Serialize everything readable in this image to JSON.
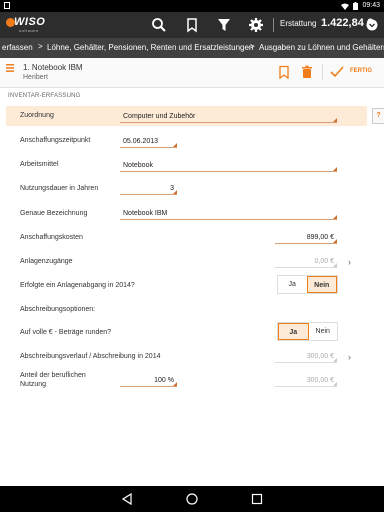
{
  "statusbar": {
    "time": "09:43"
  },
  "appbar": {
    "brand": "WISO",
    "brand_sub": "software",
    "erstattung_label": "Erstattung",
    "erstattung_value": "1.422,84 €"
  },
  "breadcrumb": {
    "items": [
      "erfassen",
      "Löhne, Gehälter, Pensionen, Renten und Ersatzleistungen",
      "Ausgaben zu Löhnen und Gehältern"
    ]
  },
  "header": {
    "title": "1. Notebook IBM",
    "subtitle": "Heribert",
    "done_label": "FERTIG"
  },
  "section_title": "INVENTAR-ERFASSUNG",
  "side_tab": "?",
  "form": {
    "zuordnung": {
      "label": "Zuordnung",
      "value": "Computer und Zubehör"
    },
    "anschaffungszeitpunkt": {
      "label": "Anschaffungszeitpunkt",
      "value": "05.06.2013"
    },
    "arbeitsmittel": {
      "label": "Arbeitsmittel",
      "value": "Notebook"
    },
    "nutzungsdauer": {
      "label": "Nutzungsdauer in Jahren",
      "value": "3"
    },
    "genaue_bezeichnung": {
      "label": "Genaue Bezeichnung",
      "value": "Notebook IBM"
    },
    "anschaffungskosten": {
      "label": "Anschaffungskosten",
      "value": "899,00 €"
    },
    "anlagenzugaenge": {
      "label": "Anlagenzugänge",
      "value": "0,00 €"
    },
    "anlagenabgang": {
      "label": "Erfolgte ein Anlagenabgang in 2014?",
      "yes": "Ja",
      "no": "Nein",
      "selected": "Nein"
    },
    "abschreibungsoptionen": {
      "label": "Abschreibungsoptionen:"
    },
    "runden": {
      "label": "Auf volle € - Beträge runden?",
      "yes": "Ja",
      "no": "Nein",
      "selected": "Ja"
    },
    "abschreibungsverlauf": {
      "label": "Abschreibungsverlauf / Abschreibung in 2014",
      "value": "300,00 €"
    },
    "anteil": {
      "label_line1": "Anteil der beruflichen",
      "label_line2": "Nutzung",
      "percent": "100 %",
      "value": "300,00 €"
    }
  },
  "colors": {
    "accent": "#f07d1a",
    "appbar": "#2d2d2d",
    "breadcrumb": "#404040",
    "highlight": "#fdebd8"
  },
  "icons": [
    "search-icon",
    "bookmark-icon",
    "filter-icon",
    "gear-icon",
    "chevron-down-icon",
    "menu-icon",
    "bookmark-icon",
    "trash-icon",
    "check-icon",
    "chevron-right-icon",
    "back-icon",
    "home-icon",
    "recents-icon"
  ]
}
